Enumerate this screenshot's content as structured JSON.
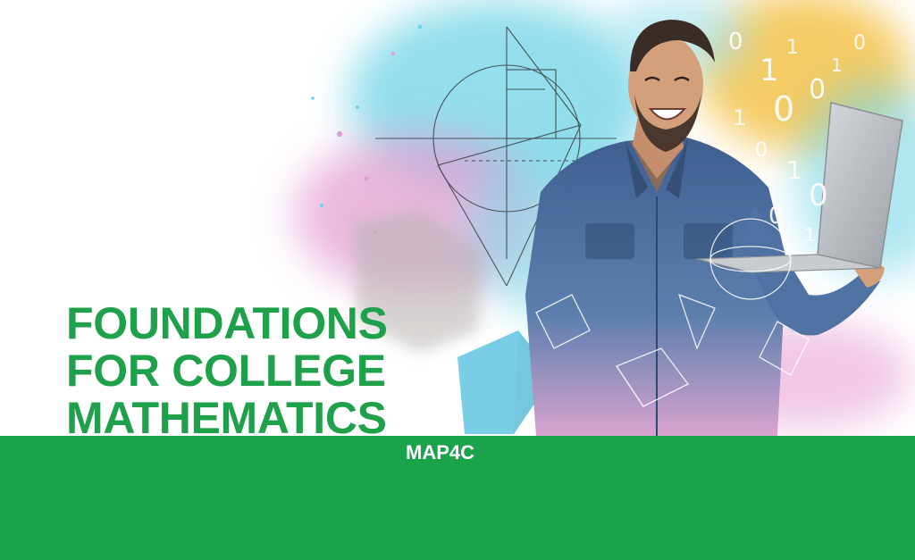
{
  "banner": {
    "title_lines": [
      "FOUNDATIONS",
      "FOR COLLEGE",
      "MATHEMATICS"
    ],
    "course_code": "MAP4C"
  },
  "colors": {
    "title_green": "#1fa04b",
    "band_green": "#1aa34a",
    "splash_cyan": "#6fd3e6",
    "splash_pink": "#e39ad0",
    "splash_yellow": "#f4c24a",
    "shirt_blue": "#4b6b96"
  },
  "illustration": {
    "subject": "smiling-man-holding-laptop",
    "decorations": [
      "watercolor-splash",
      "geometry-sketch",
      "binary-digits",
      "wireframe-shapes"
    ]
  }
}
